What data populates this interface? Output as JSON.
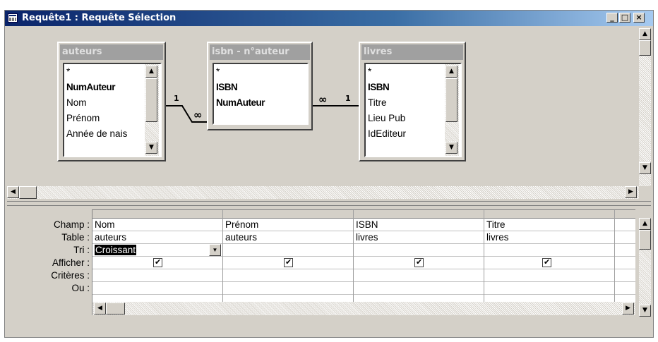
{
  "window": {
    "title": "Requête1 : Requête Sélection",
    "min_label": "_",
    "max_label": "□",
    "close_label": "×"
  },
  "tables": [
    {
      "name": "auteurs",
      "fields": [
        "*",
        "NumAuteur",
        "Nom",
        "Prénom",
        "Année de nais"
      ],
      "bold": [
        false,
        true,
        false,
        false,
        false
      ]
    },
    {
      "name": "isbn - n°auteur",
      "fields": [
        "*",
        "ISBN",
        "NumAuteur"
      ],
      "bold": [
        false,
        true,
        true
      ]
    },
    {
      "name": "livres",
      "fields": [
        "*",
        "ISBN",
        "Titre",
        "Lieu Pub",
        "IdEditeur"
      ],
      "bold": [
        false,
        true,
        false,
        false,
        false
      ]
    }
  ],
  "relations": [
    {
      "one": "1",
      "many": "∞"
    },
    {
      "one": "1",
      "many": "∞"
    }
  ],
  "grid": {
    "row_labels": [
      "Champ :",
      "Table :",
      "Tri :",
      "Afficher :",
      "Critères :",
      "Ou :"
    ],
    "columns": [
      {
        "champ": "Nom",
        "table": "auteurs",
        "tri": "Croissant",
        "afficher": true
      },
      {
        "champ": "Prénom",
        "table": "auteurs",
        "tri": "",
        "afficher": true
      },
      {
        "champ": "ISBN",
        "table": "livres",
        "tri": "",
        "afficher": true
      },
      {
        "champ": "Titre",
        "table": "livres",
        "tri": "",
        "afficher": true
      }
    ]
  },
  "icons": {
    "arrow_up": "▲",
    "arrow_down": "▼",
    "arrow_left": "◀",
    "arrow_right": "▶",
    "dropdown": "▼"
  }
}
